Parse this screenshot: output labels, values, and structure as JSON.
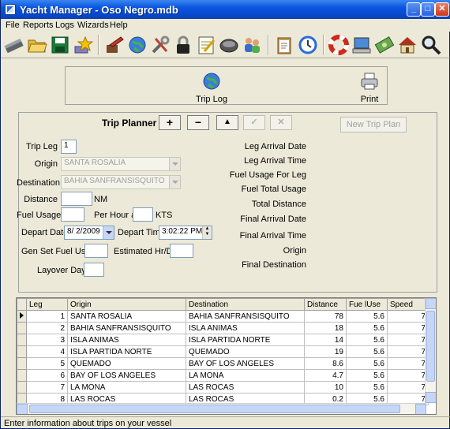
{
  "window": {
    "title": "Yacht Manager - Oso Negro.mdb"
  },
  "menu": [
    "File",
    "Reports",
    "Logs",
    "Wizards",
    "Help"
  ],
  "toolbar_icons": [
    "ruler-icon",
    "folder-open-icon",
    "save-icon",
    "star-icon",
    "paint-icon",
    "globe-icon",
    "tools-icon",
    "padlock-icon",
    "notepad-icon",
    "engine-icon",
    "people-icon",
    "clipboard-icon",
    "clock-icon",
    "life-ring-icon",
    "computer-icon",
    "money-icon",
    "house-icon",
    "magnifier-icon"
  ],
  "top_actions": {
    "trip_log": "Trip Log",
    "print": "Print"
  },
  "planner": {
    "title": "Trip Planner",
    "nav": {
      "add": "+",
      "remove": "−",
      "up": "▲",
      "confirm": "✓",
      "cancel": "✕"
    },
    "new_plan": "New Trip Plan",
    "labels": {
      "trip_leg": "Trip Leg",
      "origin": "Origin",
      "destination": "Destination",
      "distance": "Distance",
      "nm": "NM",
      "fuel_usage": "Fuel Usage",
      "per_hour_at": "Per Hour at",
      "kts": "KTS",
      "depart_date": "Depart Date",
      "depart_time": "Depart Time",
      "gen_set": "Gen Set Fuel Usage",
      "estimated": "Estimated Hr/Day",
      "layover": "Layover Days"
    },
    "values": {
      "trip_leg": "1",
      "origin": "SANTA ROSALIA",
      "destination": "BAHIA SANFRANSISQUITO",
      "distance": "",
      "fuel_usage": "",
      "kts": "",
      "depart_date": "8/  2/2009",
      "depart_time": "3:02:22 PM",
      "gen_set": "",
      "estimated": "",
      "layover": ""
    },
    "right_labels": [
      "Leg Arrival Date",
      "Leg Arrival Time",
      "Fuel Usage For Leg",
      "Fuel Total Usage",
      "Total Distance",
      "Final Arrival Date",
      "Final Arrival Time",
      "Origin",
      "Final Destination"
    ]
  },
  "grid": {
    "columns": [
      "Leg",
      "Origin",
      "Destination",
      "Distance",
      "Fue lUse",
      "Speed"
    ],
    "rows": [
      [
        "1",
        "SANTA ROSALIA",
        "BAHIA SANFRANSISQUITO",
        "78",
        "5.6",
        "7"
      ],
      [
        "2",
        "BAHIA SANFRANSISQUITO",
        "ISLA ANIMAS",
        "18",
        "5.6",
        "7"
      ],
      [
        "3",
        "ISLA ANIMAS",
        "ISLA PARTIDA NORTE",
        "14",
        "5.6",
        "7"
      ],
      [
        "4",
        "ISLA PARTIDA NORTE",
        "QUEMADO",
        "19",
        "5.6",
        "7"
      ],
      [
        "5",
        "QUEMADO",
        "BAY OF LOS ANGELES",
        "8.6",
        "5.6",
        "7"
      ],
      [
        "6",
        "BAY OF LOS ANGELES",
        "LA MONA",
        "4.7",
        "5.6",
        "7"
      ],
      [
        "7",
        "LA MONA",
        "LAS ROCAS",
        "10",
        "5.6",
        "7"
      ],
      [
        "8",
        "LAS ROCAS",
        "LAS ROCAS",
        "0.2",
        "5.6",
        "7"
      ]
    ]
  },
  "status": "Enter information about trips on your vessel"
}
